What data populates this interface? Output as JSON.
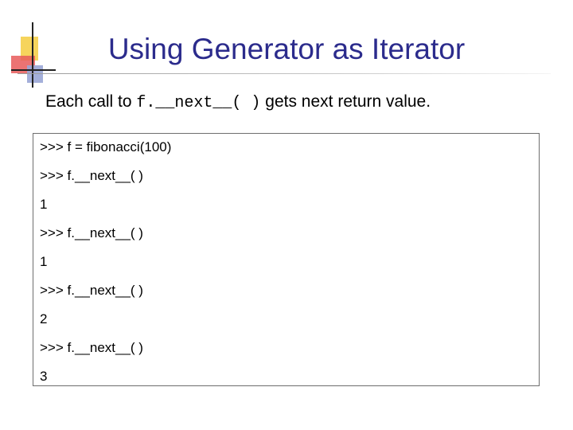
{
  "slide": {
    "title": "Using Generator as Iterator",
    "bullet": {
      "prefix": "Each call to ",
      "code": "f.__next__( )",
      "suffix": " gets next return value."
    },
    "code_lines": [
      ">>> f = fibonacci(100)",
      ">>> f.__next__( )",
      "1",
      ">>> f.__next__( )",
      "1",
      ">>> f.__next__( )",
      "2",
      ">>> f.__next__( )",
      "3"
    ]
  },
  "colors": {
    "title": "#2b2b8c",
    "deco_yellow": "#f6d45c",
    "deco_red": "#e85a5a",
    "deco_blue": "#9aa6d6",
    "code_border": "#6e6e6e"
  }
}
